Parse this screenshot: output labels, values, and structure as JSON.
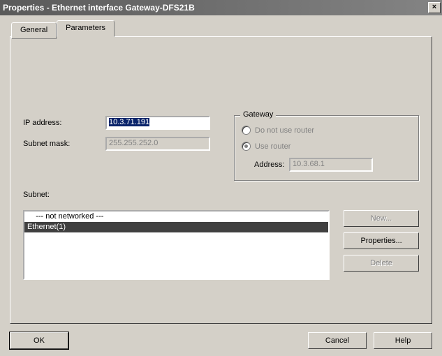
{
  "title": "Properties - Ethernet interface  Gateway-DFS21B",
  "tabs": {
    "general": "General",
    "parameters": "Parameters"
  },
  "fields": {
    "ip_label": "IP address:",
    "ip_value": "10.3.71.191",
    "mask_label": "Subnet mask:",
    "mask_value": "255.255.252.0"
  },
  "gateway": {
    "legend": "Gateway",
    "opt_no_router": "Do not use router",
    "opt_use_router": "Use router",
    "addr_label": "Address:",
    "addr_value": "10.3.68.1",
    "selected": "use_router"
  },
  "subnet": {
    "label": "Subnet:",
    "items": [
      {
        "text": "    --- not networked ---",
        "selected": false
      },
      {
        "text": "Ethernet(1)",
        "selected": true
      }
    ]
  },
  "subnet_buttons": {
    "new": "New...",
    "properties": "Properties...",
    "delete": "Delete"
  },
  "footer": {
    "ok": "OK",
    "cancel": "Cancel",
    "help": "Help"
  },
  "close": "×"
}
